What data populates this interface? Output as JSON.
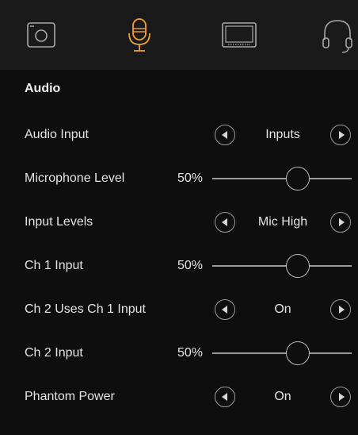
{
  "colors": {
    "active_tab": "#f0a030",
    "inactive_tab": "#a8a8a8",
    "background": "#0e0e0e",
    "tabbar_background": "#1a1a1a"
  },
  "tabs": [
    {
      "icon": "camera-icon",
      "active": false
    },
    {
      "icon": "microphone-icon",
      "active": true
    },
    {
      "icon": "monitor-icon",
      "active": false
    },
    {
      "icon": "headphones-icon",
      "active": false
    }
  ],
  "section": {
    "title": "Audio"
  },
  "settings": {
    "audio_input": {
      "label": "Audio Input",
      "value": "Inputs"
    },
    "microphone_level": {
      "label": "Microphone Level",
      "value": "50%",
      "level": 0.5
    },
    "input_levels": {
      "label": "Input Levels",
      "value": "Mic High"
    },
    "ch1_input": {
      "label": "Ch 1 Input",
      "value": "50%",
      "level": 0.5
    },
    "ch2_uses_ch1": {
      "label": "Ch 2 Uses Ch 1 Input",
      "value": "On"
    },
    "ch2_input": {
      "label": "Ch 2 Input",
      "value": "50%",
      "level": 0.5
    },
    "phantom_power": {
      "label": "Phantom Power",
      "value": "On"
    }
  }
}
